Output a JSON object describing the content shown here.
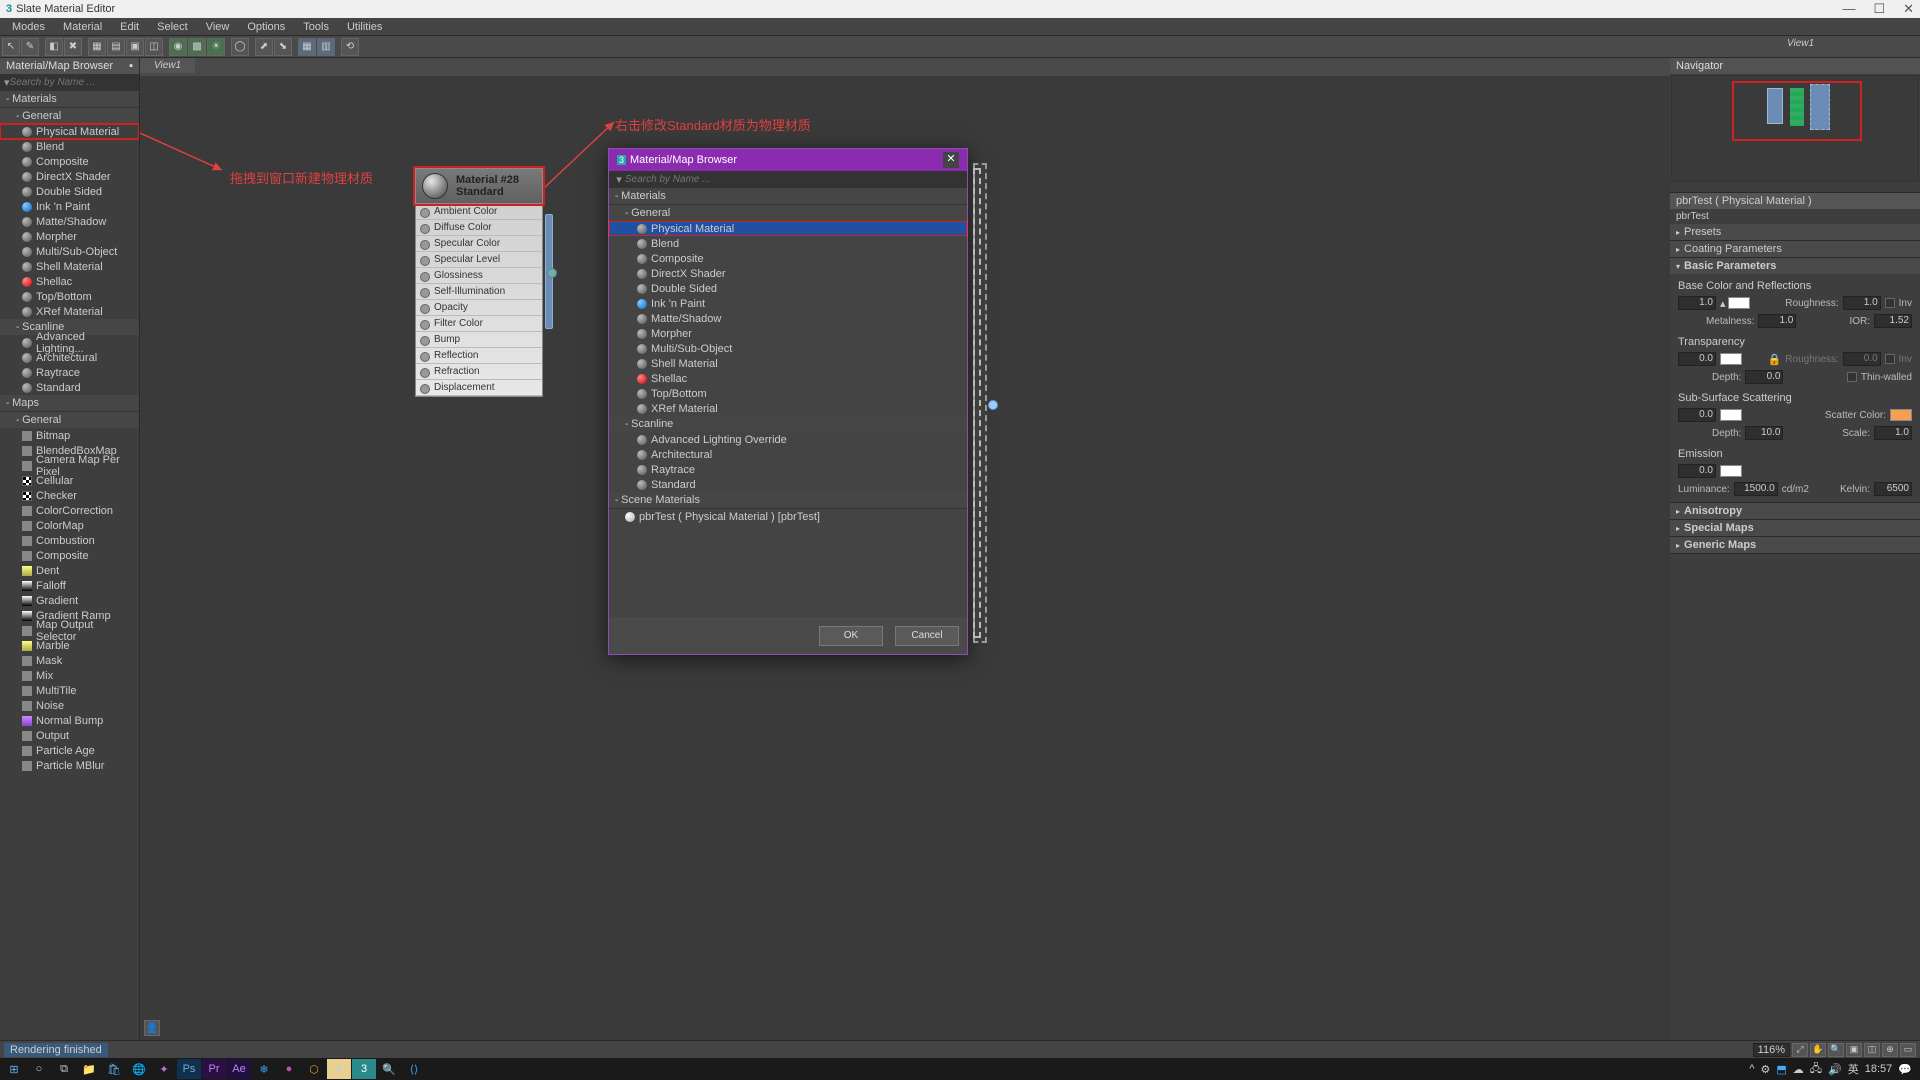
{
  "window": {
    "title": "Slate Material Editor",
    "min": "—",
    "max": "☐",
    "close": "✕"
  },
  "menus": [
    "Modes",
    "Material",
    "Edit",
    "Select",
    "View",
    "Options",
    "Tools",
    "Utilities"
  ],
  "view_tab": "View1",
  "browser": {
    "title": "Material/Map Browser",
    "search_placeholder": "Search by Name ...",
    "cats": {
      "materials": "Materials",
      "general": "General",
      "scanline": "Scanline",
      "maps": "Maps",
      "maps_general": "General"
    },
    "mat_general": [
      "Physical Material",
      "Blend",
      "Composite",
      "DirectX Shader",
      "Double Sided",
      "Ink 'n Paint",
      "Matte/Shadow",
      "Morpher",
      "Multi/Sub-Object",
      "Shell Material",
      "Shellac",
      "Top/Bottom",
      "XRef Material"
    ],
    "mat_scanline": [
      "Advanced Lighting...",
      "Architectural",
      "Raytrace",
      "Standard"
    ],
    "maps_general": [
      "Bitmap",
      "BlendedBoxMap",
      "Camera Map Per Pixel",
      "Cellular",
      "Checker",
      "ColorCorrection",
      "ColorMap",
      "Combustion",
      "Composite",
      "Dent",
      "Falloff",
      "Gradient",
      "Gradient Ramp",
      "Map Output Selector",
      "Marble",
      "Mask",
      "Mix",
      "MultiTile",
      "Noise",
      "Normal Bump",
      "Output",
      "Particle Age",
      "Particle MBlur"
    ]
  },
  "annotations": {
    "drag": "拖拽到窗口新建物理材质",
    "rightclick": "右击修改Standard材质为物理材质"
  },
  "node": {
    "name": "Material #28",
    "type": "Standard",
    "slots": [
      "Ambient Color",
      "Diffuse Color",
      "Specular Color",
      "Specular Level",
      "Glossiness",
      "Self-Illumination",
      "Opacity",
      "Filter Color",
      "Bump",
      "Reflection",
      "Refraction",
      "Displacement"
    ]
  },
  "dialog": {
    "title": "Material/Map Browser",
    "search_placeholder": "Search by Name ...",
    "materials": "Materials",
    "general": "General",
    "mat_general": [
      "Physical Material",
      "Blend",
      "Composite",
      "DirectX Shader",
      "Double Sided",
      "Ink 'n Paint",
      "Matte/Shadow",
      "Morpher",
      "Multi/Sub-Object",
      "Shell Material",
      "Shellac",
      "Top/Bottom",
      "XRef Material"
    ],
    "scanline_label": "Scanline",
    "mat_scanline": [
      "Advanced Lighting Override",
      "Architectural",
      "Raytrace",
      "Standard"
    ],
    "scene_label": "Scene Materials",
    "scene_item": "pbrTest  ( Physical Material )  [pbrTest]",
    "ok": "OK",
    "cancel": "Cancel"
  },
  "right": {
    "view_tab": "View1",
    "navigator": "Navigator",
    "param_title": "pbrTest  ( Physical Material )",
    "param_name": "pbrTest",
    "rollouts": {
      "presets": "Presets",
      "coating": "Coating Parameters",
      "basic": "Basic Parameters",
      "anisotropy": "Anisotropy",
      "special": "Special Maps",
      "generic": "Generic Maps"
    },
    "basic": {
      "section_base": "Base Color and Reflections",
      "v1": "1.0",
      "roughness_l": "Roughness:",
      "roughness_v": "1.0",
      "inv": "Inv",
      "metalness_l": "Metalness:",
      "metalness_v": "1.0",
      "ior_l": "IOR:",
      "ior_v": "1.52",
      "section_trans": "Transparency",
      "t_v": "0.0",
      "t_rough_l": "Roughness:",
      "t_rough_v": "0.0",
      "depth_l": "Depth:",
      "depth_v": "0.0",
      "thin_l": "Thin-walled",
      "section_sss": "Sub-Surface Scattering",
      "sss_v": "0.0",
      "scatter_l": "Scatter Color:",
      "sdepth_l": "Depth:",
      "sdepth_v": "10.0",
      "scale_l": "Scale:",
      "scale_v": "1.0",
      "section_emit": "Emission",
      "emit_v": "0.0",
      "lum_l": "Luminance:",
      "lum_v": "1500.0",
      "lum_unit": "cd/m2",
      "kelvin_l": "Kelvin:",
      "kelvin_v": "6500"
    }
  },
  "status": {
    "text": "Rendering finished",
    "zoom": "116%"
  },
  "taskbar": {
    "lang": "英",
    "time": "18:57",
    "chev": "^"
  }
}
